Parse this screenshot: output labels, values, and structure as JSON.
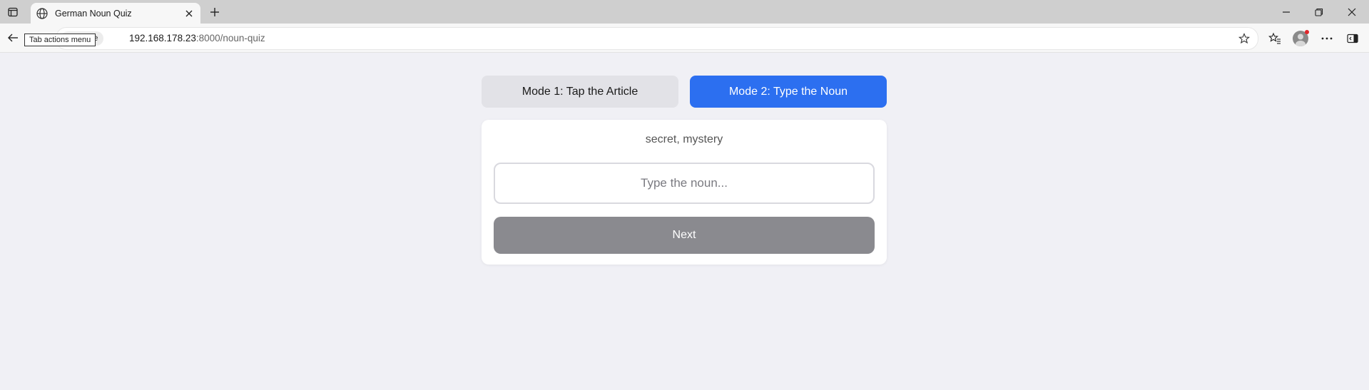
{
  "browser": {
    "tab": {
      "title": "German Noun Quiz"
    },
    "tooltip": "Tab actions menu",
    "address": {
      "security_label": "cure",
      "url_host": "192.168.178.23",
      "url_rest": ":8000/noun-quiz"
    }
  },
  "quiz": {
    "modes": [
      {
        "label": "Mode 1: Tap the Article",
        "active": false
      },
      {
        "label": "Mode 2: Type the Noun",
        "active": true
      }
    ],
    "prompt": "secret, mystery",
    "input": {
      "value": "",
      "placeholder": "Type the noun..."
    },
    "next_label": "Next"
  },
  "colors": {
    "accent": "#2c6ff0",
    "next_button": "#8a8a8f",
    "page_background": "#f0f0f5"
  }
}
